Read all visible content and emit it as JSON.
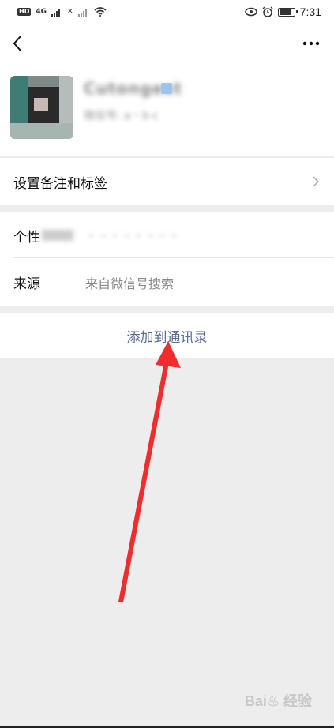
{
  "status_bar": {
    "network_badge": "HD",
    "signal_1": "4G",
    "signal_2": "✕",
    "time": "7:31",
    "battery_level": 0.9
  },
  "header": {
    "back_icon": "chevron-left-icon",
    "more_icon": "more-dots-icon"
  },
  "profile": {
    "name": "Cutongest",
    "wechat_id": "微信号: a・b·c"
  },
  "rows": {
    "remark_label": "设置备注和标签",
    "signature_label": "个性",
    "signature_value": "・・・・・・・・",
    "source_label": "来源",
    "source_value": "来自微信号搜索"
  },
  "actions": {
    "add_contact": "添加到通讯录"
  },
  "colors": {
    "accent": "#576b95",
    "arrow": "#f02c2c"
  }
}
